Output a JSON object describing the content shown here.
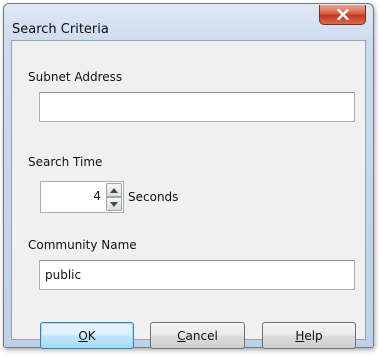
{
  "window": {
    "title": "Search Criteria",
    "close_icon": "close-x-icon"
  },
  "subnet": {
    "label": "Subnet Address",
    "value": ""
  },
  "search_time": {
    "label": "Search Time",
    "value": "4",
    "unit": "Seconds",
    "up_icon": "spin-up-arrow-icon",
    "down_icon": "spin-down-arrow-icon"
  },
  "community": {
    "label": "Community Name",
    "value": "public"
  },
  "buttons": {
    "ok": {
      "mnemonic": "O",
      "rest": "K"
    },
    "cancel": {
      "mnemonic": "C",
      "rest": "ancel"
    },
    "help": {
      "mnemonic": "H",
      "rest": "elp"
    }
  },
  "colors": {
    "close_button": "#c3381f",
    "default_button_border": "#3c7fb1"
  }
}
